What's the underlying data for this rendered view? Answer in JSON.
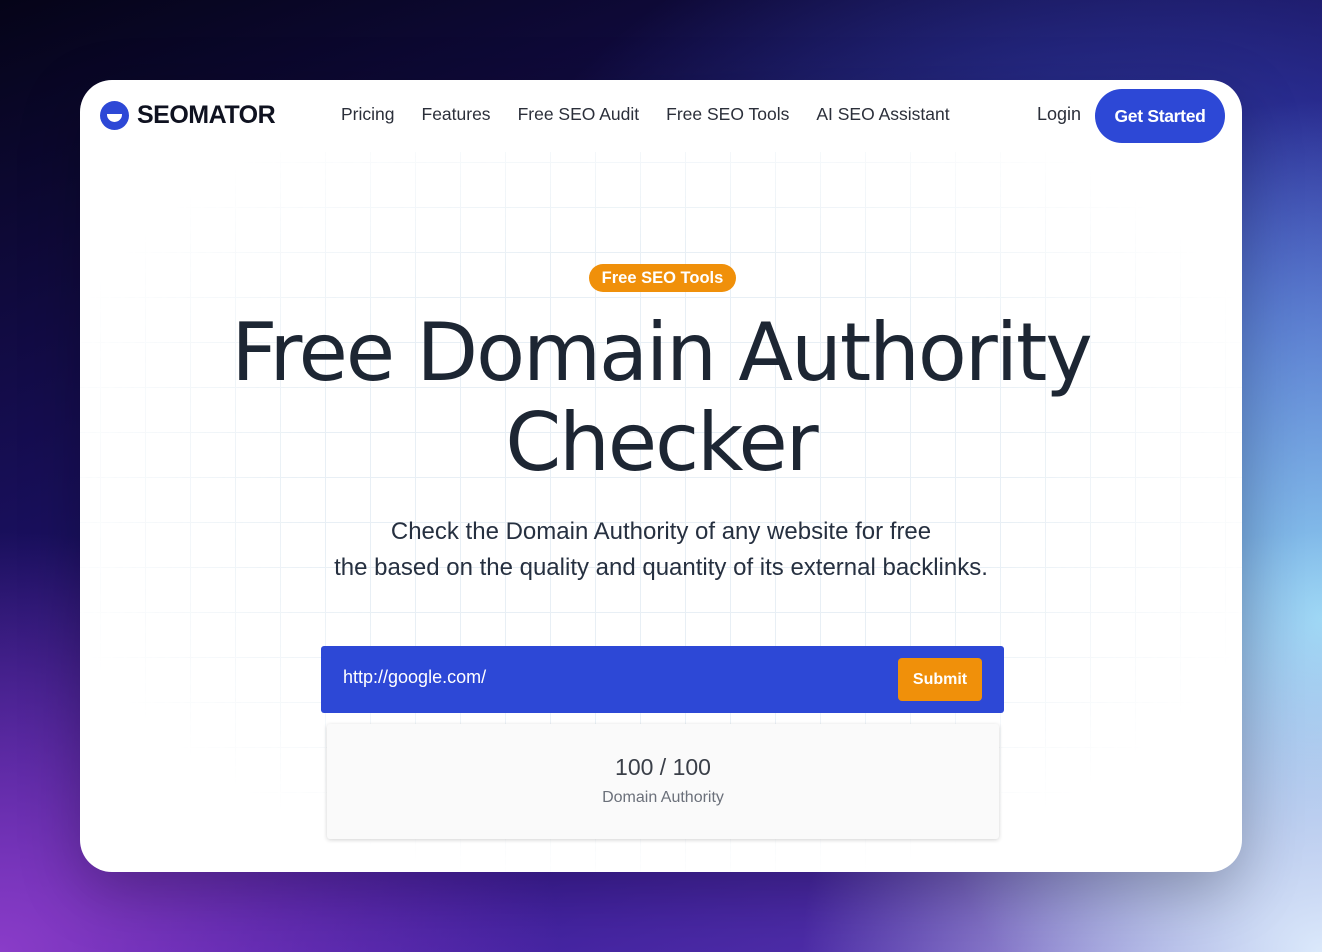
{
  "brand": {
    "name": "SEOMATOR",
    "icon": "seomator-logo-icon",
    "color": "#2d48d6"
  },
  "nav": {
    "links": [
      "Pricing",
      "Features",
      "Free SEO Audit",
      "Free SEO Tools",
      "AI SEO Assistant"
    ],
    "login": "Login",
    "cta": "Get Started"
  },
  "hero": {
    "badge": "Free SEO Tools",
    "title_line1": "Free Domain Authority",
    "title_line2": "Checker",
    "subtitle_line1": "Check the Domain Authority of any website for free",
    "subtitle_line2": "the based on the quality and quantity of its external backlinks."
  },
  "checker": {
    "url_value": "http://google.com/",
    "submit_label": "Submit"
  },
  "result": {
    "score": "100 / 100",
    "label": "Domain Authority"
  },
  "colors": {
    "accent": "#2d48d6",
    "badge": "#f0900a",
    "text": "#1d2633"
  }
}
